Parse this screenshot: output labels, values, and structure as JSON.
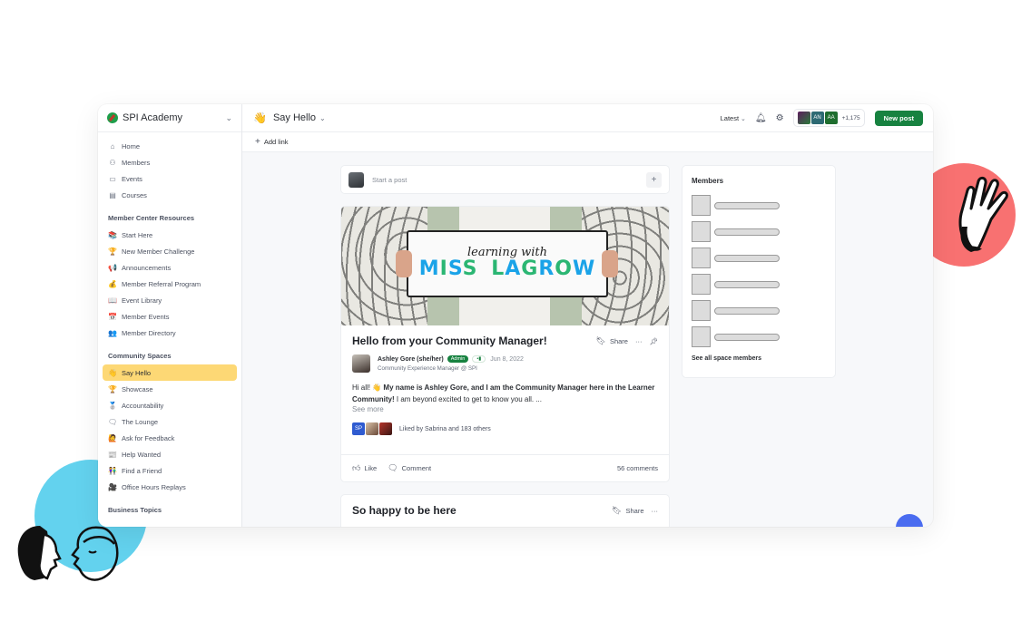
{
  "brand": {
    "name": "SPI Academy"
  },
  "sidebar": {
    "main_items": [
      {
        "icon": "home-icon",
        "glyph": "⌂",
        "label": "Home"
      },
      {
        "icon": "members-icon",
        "glyph": "⚇",
        "label": "Members"
      },
      {
        "icon": "calendar-icon",
        "glyph": "▭",
        "label": "Events"
      },
      {
        "icon": "courses-icon",
        "glyph": "▤",
        "label": "Courses"
      }
    ],
    "sections": [
      {
        "title": "Member Center Resources",
        "items": [
          {
            "icon": "flag-book-icon",
            "glyph": "📚",
            "label": "Start Here"
          },
          {
            "icon": "trophy-icon",
            "glyph": "🏆",
            "label": "New Member Challenge"
          },
          {
            "icon": "megaphone-icon",
            "glyph": "📢",
            "label": "Announcements"
          },
          {
            "icon": "money-bag-icon",
            "glyph": "💰",
            "label": "Member Referral Program"
          },
          {
            "icon": "open-book-icon",
            "glyph": "📖",
            "label": "Event Library"
          },
          {
            "icon": "calendar-emoji-icon",
            "glyph": "📅",
            "label": "Member Events"
          },
          {
            "icon": "people-icon",
            "glyph": "👥",
            "label": "Member Directory"
          }
        ]
      },
      {
        "title": "Community Spaces",
        "items": [
          {
            "icon": "waving-hand-icon",
            "glyph": "👋",
            "label": "Say Hello",
            "active": true
          },
          {
            "icon": "trophy-icon",
            "glyph": "🏆",
            "label": "Showcase"
          },
          {
            "icon": "medal-icon",
            "glyph": "🥈",
            "label": "Accountability"
          },
          {
            "icon": "speech-bubble-icon",
            "glyph": "🗨",
            "label": "The Lounge"
          },
          {
            "icon": "raised-hand-icon",
            "glyph": "🙋",
            "label": "Ask for Feedback"
          },
          {
            "icon": "newspaper-icon",
            "glyph": "📰",
            "label": "Help Wanted"
          },
          {
            "icon": "people-holding-hands-icon",
            "glyph": "👫",
            "label": "Find a Friend"
          },
          {
            "icon": "video-camera-icon",
            "glyph": "🎥",
            "label": "Office Hours Replays"
          }
        ]
      },
      {
        "title": "Business Topics",
        "items": []
      }
    ]
  },
  "header": {
    "space_emoji": "👋",
    "space_title": "Say Hello",
    "sort_label": "Latest",
    "member_avatars": [
      "",
      "AN",
      "AA"
    ],
    "member_count": "+1,175",
    "new_post_label": "New post",
    "add_link_label": "Add link"
  },
  "composer": {
    "placeholder": "Start a post"
  },
  "post": {
    "cover_script": "learning with",
    "cover_letters": [
      "M",
      "I",
      "S",
      "S",
      " ",
      "L",
      "A",
      "G",
      "R",
      "O",
      "W"
    ],
    "title": "Hello from your Community Manager!",
    "share_label": "Share",
    "author_name": "Ashley Gore (she/her)",
    "author_badge": "Admin",
    "author_level": "•▮",
    "date": "Jun 8, 2022",
    "author_role": "Community Experience Manager @ SPI",
    "text_intro": "Hi all! 👋 ",
    "text_bold_1": "My name is Ashley Gore, and I am the Community Manager here in the Learner Community!",
    "text_rest": " I am beyond excited to get to know you all.  ...",
    "see_more": "See more",
    "liker_initials": "SP",
    "likes_text": "Liked by Sabrina and 183 others",
    "like_label": "Like",
    "comment_label": "Comment",
    "comments_count": "56 comments"
  },
  "post2": {
    "title": "So happy to be here",
    "share_label": "Share"
  },
  "members_widget": {
    "title": "Members",
    "placeholder_rows": 6,
    "see_all_label": "See all space members"
  }
}
